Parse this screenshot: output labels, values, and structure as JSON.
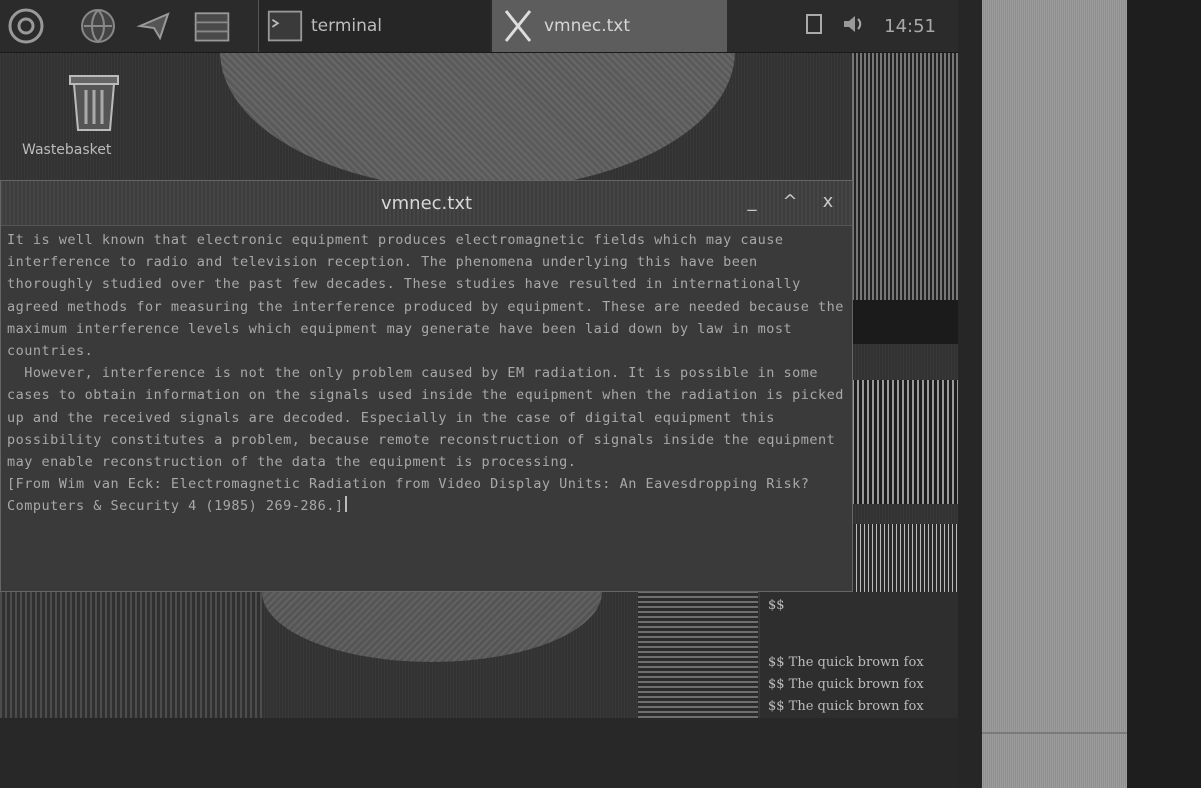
{
  "panel": {
    "tasks": [
      {
        "label": "terminal"
      },
      {
        "label": "vmnec.txt"
      }
    ],
    "tray_time": "14:51"
  },
  "desktop": {
    "trash_label": "Wastebasket"
  },
  "editor": {
    "title": "vmnec.txt",
    "minimize_glyph": "_",
    "maximize_glyph": "^",
    "close_glyph": "x",
    "text": "It is well known that electronic equipment produces electromagnetic fields which may cause interference to radio and television reception. The phenomena underlying this have been thoroughly studied over the past few decades. These studies have resulted in internationally agreed methods for measuring the interference produced by equipment. These are needed because the maximum interference levels which equipment may generate have been laid down by law in most countries.\n  However, interference is not the only problem caused by EM radiation. It is possible in some cases to obtain information on the signals used inside the equipment when the radiation is picked up and the received signals are decoded. Especially in the case of digital equipment this possibility constitutes a problem, because remote reconstruction of signals inside the equipment may enable reconstruction of the data the equipment is processing.\n[From Wim van Eck: Electromagnetic Radiation from Video Display Units: An Eavesdropping Risk? Computers & Security 4 (1985) 269-286.]"
  },
  "background_terminal": {
    "prompt": "$$",
    "lines": [
      "$$ The quick brown fox",
      "$$ The quick brown fox",
      "$$ The quick brown fox"
    ]
  }
}
